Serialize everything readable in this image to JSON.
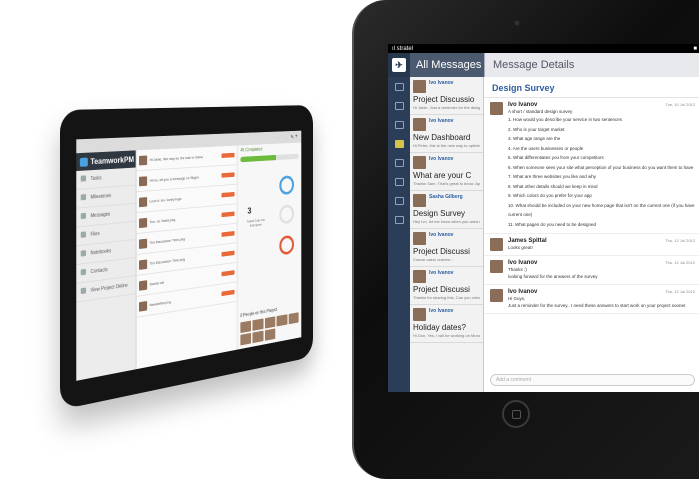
{
  "left_app": {
    "brand": "TeamworkPM",
    "nav": [
      "Tasks",
      "Milestones",
      "Messages",
      "Files",
      "Notebooks",
      "Contacts",
      "View Project Online"
    ],
    "progress_label": "45 Completed",
    "progress_value": 0.6,
    "tasks_due_count": "3",
    "tasks_due_label": "Tasks Due For Everyone",
    "people_title": "8 People on this Project",
    "feed": [
      "Hi Jarlie, this may be the task to follow",
      "Hi Ivo, let you a message on Skype",
      "Love it, lev. lovely logo",
      "Tim, no Tasks.png",
      "Tim Discussion Time.png",
      "Tim Discussion Time.png",
      "Suede.cat",
      "Newsletter.png"
    ]
  },
  "status_bar": {
    "carrier": "ıl stratel",
    "time": "",
    "battery": "■"
  },
  "header": {
    "all_messages": "All Messages",
    "message_details": "Message Details"
  },
  "rail_icons": [
    "menu-icon",
    "list-icon",
    "check-icon",
    "message-icon",
    "milestone-icon",
    "folder-icon",
    "people-icon",
    "calendar-icon"
  ],
  "message_list": [
    {
      "author": "Ivo Ivanov",
      "title": "Project Discussio",
      "snippet": "Hi Jarlie, Just a reminder for the design survey..."
    },
    {
      "author": "Ivo Ivanov",
      "title": "New Dashboard",
      "snippet": "Hi Peter, this is the new way to optimise the dashboard..."
    },
    {
      "author": "Ivo Ivanov",
      "title": "What are your C",
      "snippet": "Thanks Sam, That's great to know. Apart from..."
    },
    {
      "author": "Sasha Gilberg",
      "title": "Design Survey",
      "snippet": "Hey Ivo, let me know when you want me to..."
    },
    {
      "author": "Ivo Ivanov",
      "title": "Project Discussi",
      "snippet": "Crarue oasrx ouenne..."
    },
    {
      "author": "Ivo Ivanov",
      "title": "Project Discussi",
      "snippet": "Thanks for sharing this, Can you checkout the design project?"
    },
    {
      "author": "Ivo Ivanov",
      "title": "Holiday dates?",
      "snippet": "Hi Don, Yes, I will be working on Monday..."
    }
  ],
  "detail": {
    "subject": "Design Survey",
    "messages": [
      {
        "author": "Ivo Ivanov",
        "date": "Tue, 10 Jul 2012",
        "intro": "A short / standard design survey",
        "items": [
          "1. How would you describe your service in two sentences",
          "2. Who is your target market",
          "3. What age range are the",
          "4. Are the users businesses or people",
          "5. What differentiates you from your competitors",
          "6. When someone sees your site what perception of your business do you want them to have",
          "7. What are three websites you like and why",
          "8. What other details should we keep in mind",
          "9. Which colors do you prefer for your app",
          "10. What should be included on your new home page that isn't on the current one (if you have current one)",
          "11. What pages do you need to be designed"
        ]
      },
      {
        "author": "James Spittal",
        "date": "Thu, 12 Jul 2012",
        "text": "Looks great!"
      },
      {
        "author": "Ivo Ivanov",
        "date": "Thu, 12 Jul 2012",
        "text": "Thanks :) \nlooking forward for the answers of the survey"
      },
      {
        "author": "Ivo Ivanov",
        "date": "Thu, 12 Jul 2012",
        "text": "Hi Guys,\nJust a reminder for the survey.. I need these answers to start work on your project sooner."
      }
    ],
    "comment_placeholder": "Add a comment"
  }
}
